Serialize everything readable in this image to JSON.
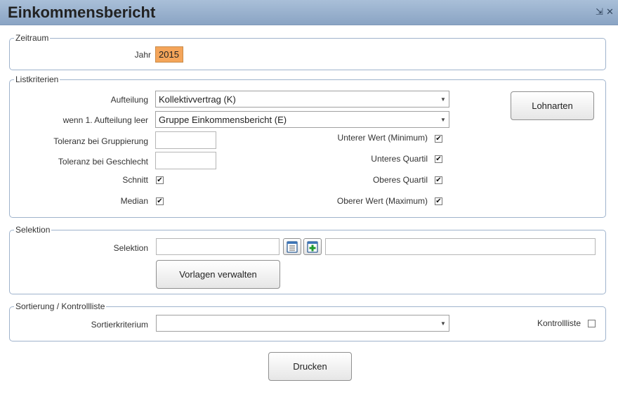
{
  "window": {
    "title": "Einkommensbericht",
    "controls": [
      "⇲",
      "✕"
    ]
  },
  "zeitraum": {
    "legend": "Zeitraum",
    "jahr_label": "Jahr",
    "jahr_value": "2015"
  },
  "listkriterien": {
    "legend": "Listkriterien",
    "aufteilung_label": "Aufteilung",
    "aufteilung_value": "Kollektivvertrag (K)",
    "wenn_label": "wenn 1. Aufteilung leer",
    "wenn_value": "Gruppe Einkommensbericht (E)",
    "toleranz_gruppierung_label": "Toleranz bei Gruppierung",
    "toleranz_gruppierung_value": "",
    "toleranz_geschlecht_label": "Toleranz bei Geschlecht",
    "toleranz_geschlecht_value": "",
    "schnitt_label": "Schnitt",
    "median_label": "Median",
    "unterer_wert_label": "Unterer Wert (Minimum)",
    "unteres_quartil_label": "Unteres Quartil",
    "oberes_quartil_label": "Oberes Quartil",
    "oberer_wert_label": "Oberer Wert (Maximum)",
    "lohnarten_button": "Lohnarten",
    "check_mark": "✔"
  },
  "selektion": {
    "legend": "Selektion",
    "selektion_label": "Selektion",
    "selektion_value": "",
    "selektion_text": "",
    "vorlagen_button": "Vorlagen verwalten"
  },
  "sortierung": {
    "legend": "Sortierung / Kontrollliste",
    "sortierkriterium_label": "Sortierkriterium",
    "sortierkriterium_value": "",
    "kontrollliste_label": "Kontrollliste"
  },
  "footer": {
    "drucken_button": "Drucken"
  },
  "icons": {
    "dropdown": "▼"
  },
  "colors": {
    "titlebar": "#98b0cf",
    "highlight_input": "#f4a55a",
    "group_border": "#9fb3cc"
  }
}
